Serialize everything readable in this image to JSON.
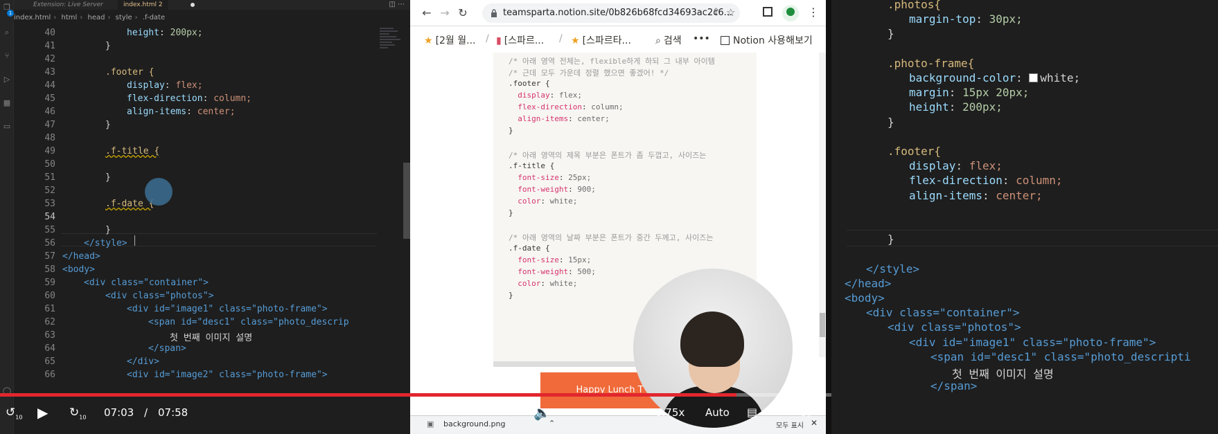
{
  "left_editor": {
    "tabs": [
      {
        "label": "Extension: Live Server"
      },
      {
        "label": "index.html 2"
      }
    ],
    "breadcrumb": [
      "index.html",
      "html",
      "head",
      "style",
      ".f-date"
    ],
    "lines": [
      {
        "n": "40",
        "t": "height: 200px;"
      },
      {
        "n": "41",
        "t": "}"
      },
      {
        "n": "42",
        "t": ""
      },
      {
        "n": "43",
        "t": ".footer {"
      },
      {
        "n": "44",
        "t": "display: flex;"
      },
      {
        "n": "45",
        "t": "flex-direction: column;"
      },
      {
        "n": "46",
        "t": "align-items: center;"
      },
      {
        "n": "47",
        "t": "}"
      },
      {
        "n": "48",
        "t": ""
      },
      {
        "n": "49",
        "t": ".f-title {"
      },
      {
        "n": "50",
        "t": ""
      },
      {
        "n": "51",
        "t": "}"
      },
      {
        "n": "52",
        "t": ""
      },
      {
        "n": "53",
        "t": ".f-date {"
      },
      {
        "n": "54",
        "t": ""
      },
      {
        "n": "55",
        "t": "}"
      },
      {
        "n": "56",
        "t": "</style>"
      },
      {
        "n": "57",
        "t": "</head>"
      },
      {
        "n": "58",
        "t": "<body>"
      },
      {
        "n": "59",
        "t": "<div class=\"container\">"
      },
      {
        "n": "60",
        "t": "<div class=\"photos\">"
      },
      {
        "n": "61",
        "t": "<div id=\"image1\" class=\"photo-frame\">"
      },
      {
        "n": "62",
        "t": "<span id=\"desc1\" class=\"photo_descrip"
      },
      {
        "n": "63",
        "t": "첫 번째 이미지 설명"
      },
      {
        "n": "64",
        "t": "</span>"
      },
      {
        "n": "65",
        "t": "</div>"
      },
      {
        "n": "66",
        "t": "<div id=\"image2\" class=\"photo-frame\">"
      }
    ]
  },
  "browser": {
    "url": "teamsparta.notion.site/0b826b68fcd34693ac2c6...",
    "breadcrumbs": [
      "[2월 월...",
      "[스파르...",
      "[스파르타..."
    ],
    "search_label": "검색",
    "more_label": "•••",
    "notion_cta": "Notion 사용해보기",
    "code_lines": [
      "/* 아래 영역 전체는, flexible하게 하되 그 내부 아이템",
      "/* 근데 모두 가운데 정렬 했으면 좋겠어! */",
      ".footer {",
      "  display: flex;",
      "  flex-direction: column;",
      "  align-items: center;",
      "}",
      "",
      "/* 아래 영역의 제목 부분은 폰트가 좀 두껍고, 사이즈는",
      ".f-title {",
      "  font-size: 25px;",
      "  font-weight: 900;",
      "  color: white;",
      "}",
      "",
      "/* 아래 영역의 날짜 부분은 폰트가 중간 두께고, 사이즈는",
      ".f-date {",
      "  font-size: 15px;",
      "  font-weight: 500;",
      "  color: white;",
      "}"
    ],
    "orange_card_text": "Happy Lunch T",
    "download": {
      "name": "background.png",
      "show_all": "모두 표시"
    }
  },
  "video": {
    "current_time": "07:03",
    "separator": "/",
    "duration": "07:58",
    "progress_fraction": 0.886,
    "volume_fraction": 0.37,
    "speed": "0.75x",
    "quality": "Auto",
    "skip_back_label": "10",
    "skip_forward_label": "10"
  },
  "right_editor": {
    "lines": [
      ".photos{",
      "margin-top: 30px;",
      "}",
      "",
      ".photo-frame{",
      "background-color: white;",
      "margin: 15px 20px;",
      "height: 200px;",
      "}",
      "",
      ".footer{",
      "display: flex;",
      "flex-direction: column;",
      "align-items: center;",
      "",
      "",
      "}",
      "",
      "</style>",
      "</head>",
      "<body>",
      "<div class=\"container\">",
      "<div class=\"photos\">",
      "<div id=\"image1\" class=\"photo-frame\">",
      "<span id=\"desc1\" class=\"photo_descripti",
      "첫 번째 이미지 설명",
      "</span>"
    ]
  },
  "colors": {
    "editor_bg": "#1e1e1e",
    "progress_red": "#e2262e",
    "notion_code_bg": "#f7f6f3",
    "orange_card": "#f06a3a"
  },
  "icons": [
    "files-icon",
    "search-icon",
    "source-control-icon",
    "run-debug-icon",
    "extensions-icon",
    "back-arrow-icon",
    "forward-arrow-icon",
    "reload-icon",
    "lock-icon",
    "share-icon",
    "bookmark-star-icon",
    "side-panel-icon",
    "profile-icon",
    "kebab-menu-icon",
    "play-icon",
    "volume-icon",
    "subtitles-icon",
    "theater-icon",
    "fullscreen-icon"
  ]
}
